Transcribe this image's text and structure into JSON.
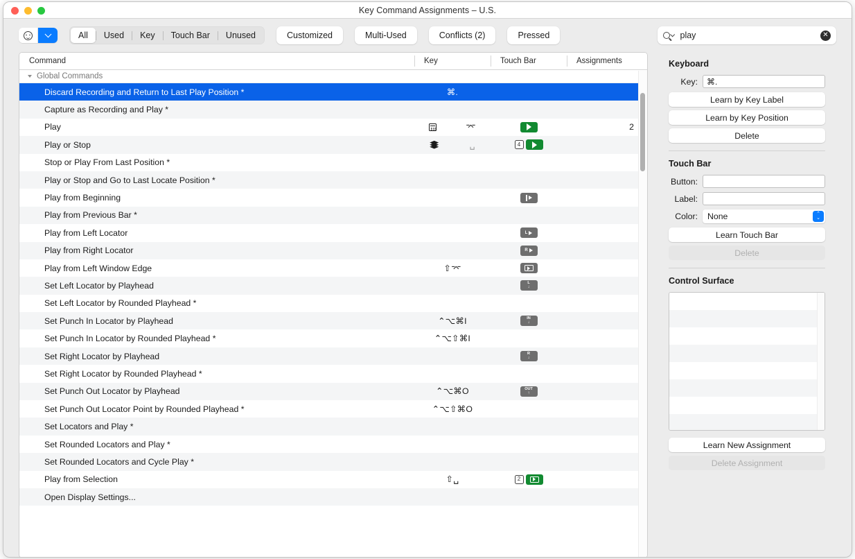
{
  "window": {
    "title": "Key Command Assignments – U.S."
  },
  "toolbar": {
    "emoji_icon": "smiley-icon",
    "dropdown_icon": "chevron-down-icon",
    "segments": [
      {
        "label": "All",
        "active": true
      },
      {
        "label": "Used",
        "active": false
      },
      {
        "label": "Key",
        "active": false
      },
      {
        "label": "Touch Bar",
        "active": false
      },
      {
        "label": "Unused",
        "active": false
      }
    ],
    "pills": [
      {
        "label": "Customized"
      },
      {
        "label": "Multi-Used"
      },
      {
        "label": "Conflicts (2)"
      },
      {
        "label": "Pressed"
      }
    ],
    "search": {
      "value": "play",
      "placeholder": "Search",
      "icon": "search-icon",
      "clear_icon": "clear-icon",
      "clear_glyph": "✕"
    }
  },
  "table": {
    "columns": [
      "Command",
      "Key",
      "Touch Bar",
      "Assignments"
    ],
    "group": {
      "label": "Global Commands",
      "expanded": true
    },
    "rows": [
      {
        "command": "Discard Recording and Return to Last Play Position *",
        "key": "⌘.",
        "key_type": "text",
        "touchbar": [],
        "assignments": "",
        "selected": true
      },
      {
        "command": "Capture as Recording and Play *",
        "key": "",
        "key_type": "none",
        "touchbar": [],
        "assignments": ""
      },
      {
        "command": "Play",
        "key": "⌤",
        "key_type": "numpad-enter",
        "touchbar": [
          {
            "kind": "green-play"
          }
        ],
        "assignments": "2"
      },
      {
        "command": "Play or Stop",
        "key": "␣",
        "key_type": "layers-space",
        "touchbar": [
          {
            "kind": "num",
            "text": "4"
          },
          {
            "kind": "green-play"
          }
        ],
        "assignments": ""
      },
      {
        "command": "Stop or Play From Last Position *",
        "key": "",
        "key_type": "none",
        "touchbar": [],
        "assignments": ""
      },
      {
        "command": "Play or Stop and Go to Last Locate Position *",
        "key": "",
        "key_type": "none",
        "touchbar": [],
        "assignments": ""
      },
      {
        "command": "Play from Beginning",
        "key": "",
        "key_type": "none",
        "touchbar": [
          {
            "kind": "bar-play"
          }
        ],
        "assignments": ""
      },
      {
        "command": "Play from Previous Bar *",
        "key": "",
        "key_type": "none",
        "touchbar": [],
        "assignments": ""
      },
      {
        "command": "Play from Left Locator",
        "key": "",
        "key_type": "none",
        "touchbar": [
          {
            "kind": "letter-play",
            "text": "L"
          }
        ],
        "assignments": ""
      },
      {
        "command": "Play from Right Locator",
        "key": "",
        "key_type": "none",
        "touchbar": [
          {
            "kind": "letter-play",
            "text": "R"
          }
        ],
        "assignments": ""
      },
      {
        "command": "Play from Left Window Edge",
        "key": "⇧⌤",
        "key_type": "text",
        "touchbar": [
          {
            "kind": "screen-play"
          }
        ],
        "assignments": ""
      },
      {
        "command": "Set Left Locator by Playhead",
        "key": "",
        "key_type": "none",
        "touchbar": [
          {
            "kind": "stack",
            "label": "L",
            "arrow": "↓"
          }
        ],
        "assignments": ""
      },
      {
        "command": "Set Left Locator by Rounded Playhead *",
        "key": "",
        "key_type": "none",
        "touchbar": [],
        "assignments": ""
      },
      {
        "command": "Set Punch In Locator by Playhead",
        "key": "⌃⌥⌘I",
        "key_type": "text",
        "touchbar": [
          {
            "kind": "stack",
            "label": "IN",
            "arrow": "↓"
          }
        ],
        "assignments": ""
      },
      {
        "command": "Set Punch In Locator by Rounded Playhead *",
        "key": "⌃⌥⇧⌘I",
        "key_type": "text",
        "touchbar": [],
        "assignments": ""
      },
      {
        "command": "Set Right Locator by Playhead",
        "key": "",
        "key_type": "none",
        "touchbar": [
          {
            "kind": "stack",
            "label": "R",
            "arrow": "↓"
          }
        ],
        "assignments": ""
      },
      {
        "command": "Set Right Locator by Rounded Playhead *",
        "key": "",
        "key_type": "none",
        "touchbar": [],
        "assignments": ""
      },
      {
        "command": "Set Punch Out Locator by Playhead",
        "key": "⌃⌥⌘O",
        "key_type": "text",
        "touchbar": [
          {
            "kind": "stack",
            "label": "OUT",
            "arrow": "↑"
          }
        ],
        "assignments": ""
      },
      {
        "command": "Set Punch Out Locator Point by Rounded Playhead *",
        "key": "⌃⌥⇧⌘O",
        "key_type": "text",
        "touchbar": [],
        "assignments": ""
      },
      {
        "command": "Set Locators and Play *",
        "key": "",
        "key_type": "none",
        "touchbar": [],
        "assignments": ""
      },
      {
        "command": "Set Rounded Locators and Play *",
        "key": "",
        "key_type": "none",
        "touchbar": [],
        "assignments": ""
      },
      {
        "command": "Set Rounded Locators and Cycle Play *",
        "key": "",
        "key_type": "none",
        "touchbar": [],
        "assignments": ""
      },
      {
        "command": "Play from Selection",
        "key": "⇧␣",
        "key_type": "text",
        "touchbar": [
          {
            "kind": "num",
            "text": "2"
          },
          {
            "kind": "green-screen-play"
          }
        ],
        "assignments": ""
      },
      {
        "command": "Open Display Settings...",
        "key": "",
        "key_type": "none",
        "touchbar": [],
        "assignments": ""
      }
    ]
  },
  "sidebar": {
    "keyboard": {
      "title": "Keyboard",
      "key_label": "Key:",
      "key_value": "⌘.",
      "buttons": [
        {
          "label": "Learn by Key Label",
          "disabled": false
        },
        {
          "label": "Learn by Key Position",
          "disabled": false
        },
        {
          "label": "Delete",
          "disabled": false
        }
      ]
    },
    "touchbar": {
      "title": "Touch Bar",
      "button_label": "Button:",
      "button_value": "",
      "label_label": "Label:",
      "label_value": "",
      "color_label": "Color:",
      "color_value": "None",
      "color_options": [
        "None"
      ],
      "buttons": [
        {
          "label": "Learn Touch Bar",
          "disabled": false
        },
        {
          "label": "Delete",
          "disabled": true
        }
      ]
    },
    "control_surface": {
      "title": "Control Surface",
      "rows": 8,
      "buttons": [
        {
          "label": "Learn New Assignment",
          "disabled": false
        },
        {
          "label": "Delete Assignment",
          "disabled": true
        }
      ]
    }
  },
  "colors": {
    "selection": "#0a62e8",
    "accent": "#0a7cff",
    "green_chip": "#128a31",
    "gray_chip": "#6e6e6e"
  }
}
